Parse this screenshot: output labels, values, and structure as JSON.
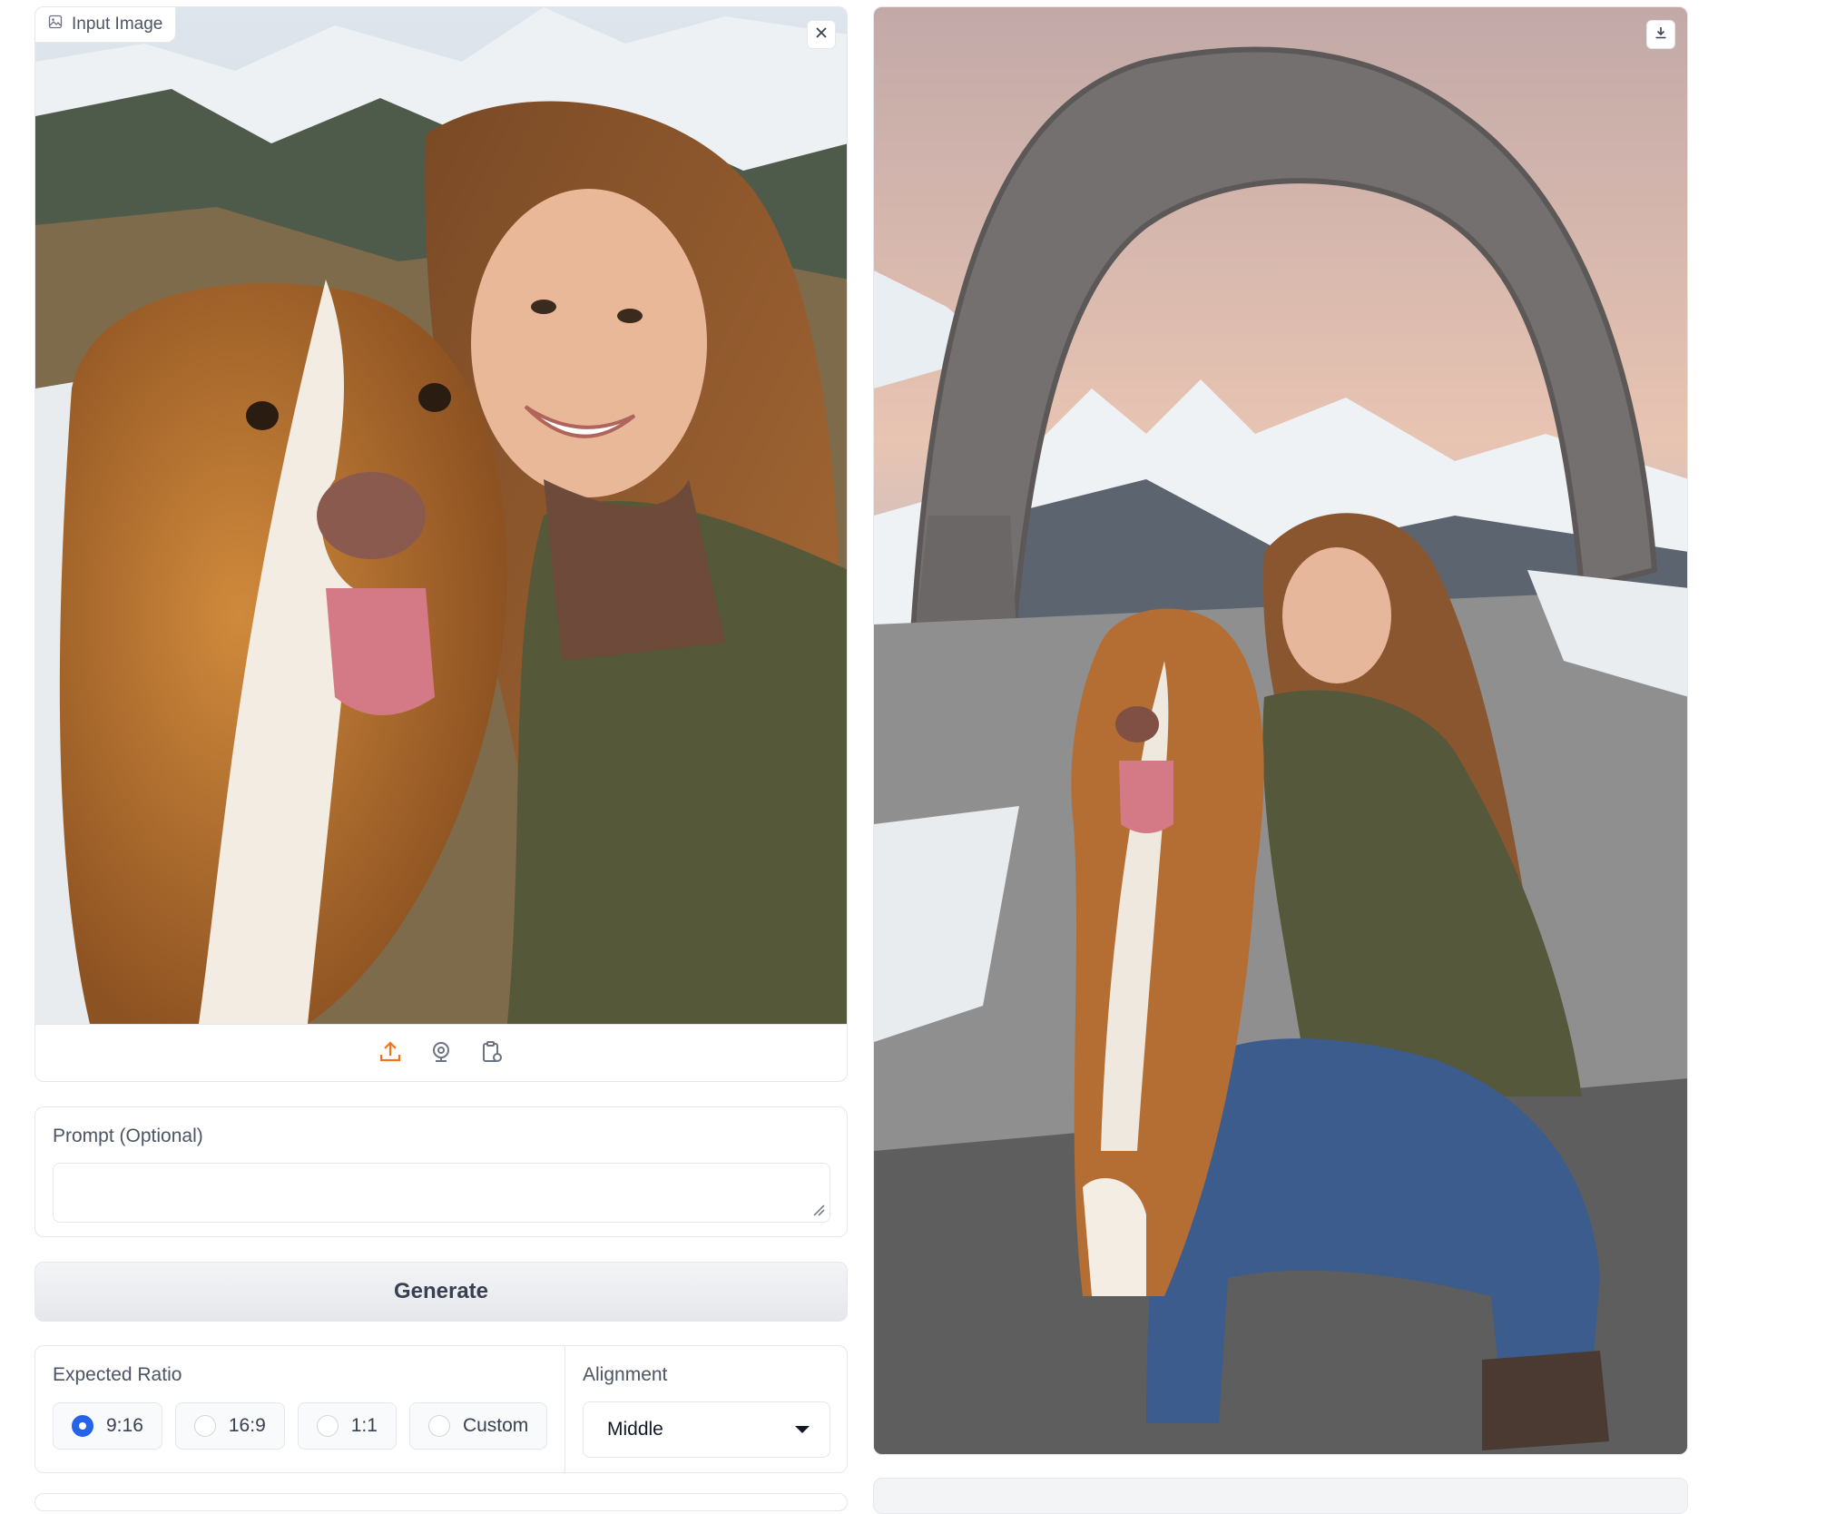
{
  "input_panel": {
    "label": "Input Image",
    "image_alt": "Selfie of a smiling woman with long brown hair hugging a brown and white dog in a snowy mountain landscape"
  },
  "prompt": {
    "label": "Prompt (Optional)",
    "value": "",
    "placeholder": ""
  },
  "generate_label": "Generate",
  "ratio": {
    "label": "Expected Ratio",
    "options": [
      "9:16",
      "16:9",
      "1:1",
      "Custom"
    ],
    "selected": "9:16"
  },
  "alignment": {
    "label": "Alignment",
    "value": "Middle"
  },
  "output_panel": {
    "image_alt": "Outpainted portrait: the woman and dog crouching on rocky snowy ground beneath a large stone arch with mountains at sunset"
  },
  "colors": {
    "accent": "#2563eb",
    "upload_icon": "#f97316",
    "border": "#e5e7eb"
  }
}
